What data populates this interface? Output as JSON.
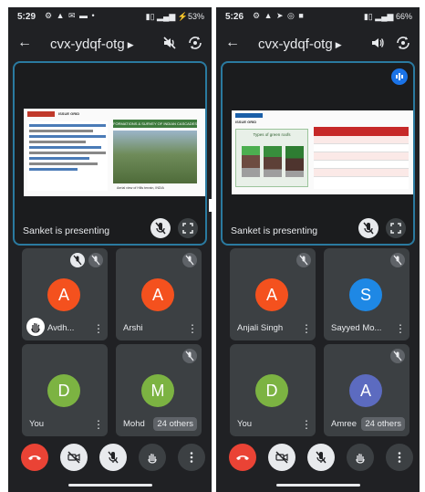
{
  "left": {
    "status": {
      "time": "5:29",
      "battery": "53%"
    },
    "meeting_code": "cvx-ydqf-otg",
    "presenter_text": "Sanket is presenting",
    "slide": {
      "header_text": "ISSUE GRID",
      "title": "FORMATIONS & SURVEY OF INDIAN CASCADES",
      "caption": "Aerial view of Hills terrain, INDIA"
    },
    "participants": [
      {
        "initial": "A",
        "name": "Avdh...",
        "color": "#f4511e"
      },
      {
        "initial": "A",
        "name": "Arshi",
        "color": "#f4511e"
      },
      {
        "initial": "D",
        "name": "You",
        "color": "#7cb342"
      },
      {
        "initial": "M",
        "name": "Mohd",
        "color": "#7cb342"
      }
    ],
    "others_label": "24 others"
  },
  "right": {
    "status": {
      "time": "5:26",
      "battery": "66%"
    },
    "meeting_code": "cvx-ydqf-otg",
    "presenter_text": "Sanket is presenting",
    "slide": {
      "header_text": "ISSUE GRID",
      "title": "Types of green roofs"
    },
    "participants": [
      {
        "initial": "A",
        "name": "Anjali Singh",
        "color": "#f4511e"
      },
      {
        "initial": "S",
        "name": "Sayyed Mo...",
        "color": "#1e88e5"
      },
      {
        "initial": "D",
        "name": "You",
        "color": "#7cb342"
      },
      {
        "initial": "A",
        "name": "Amree",
        "color": "#5c6bc0"
      }
    ],
    "others_label": "24 others"
  },
  "colors": {
    "hangup": "#ea4335",
    "tile_border": "#2a7aa0",
    "background": "#202124"
  }
}
